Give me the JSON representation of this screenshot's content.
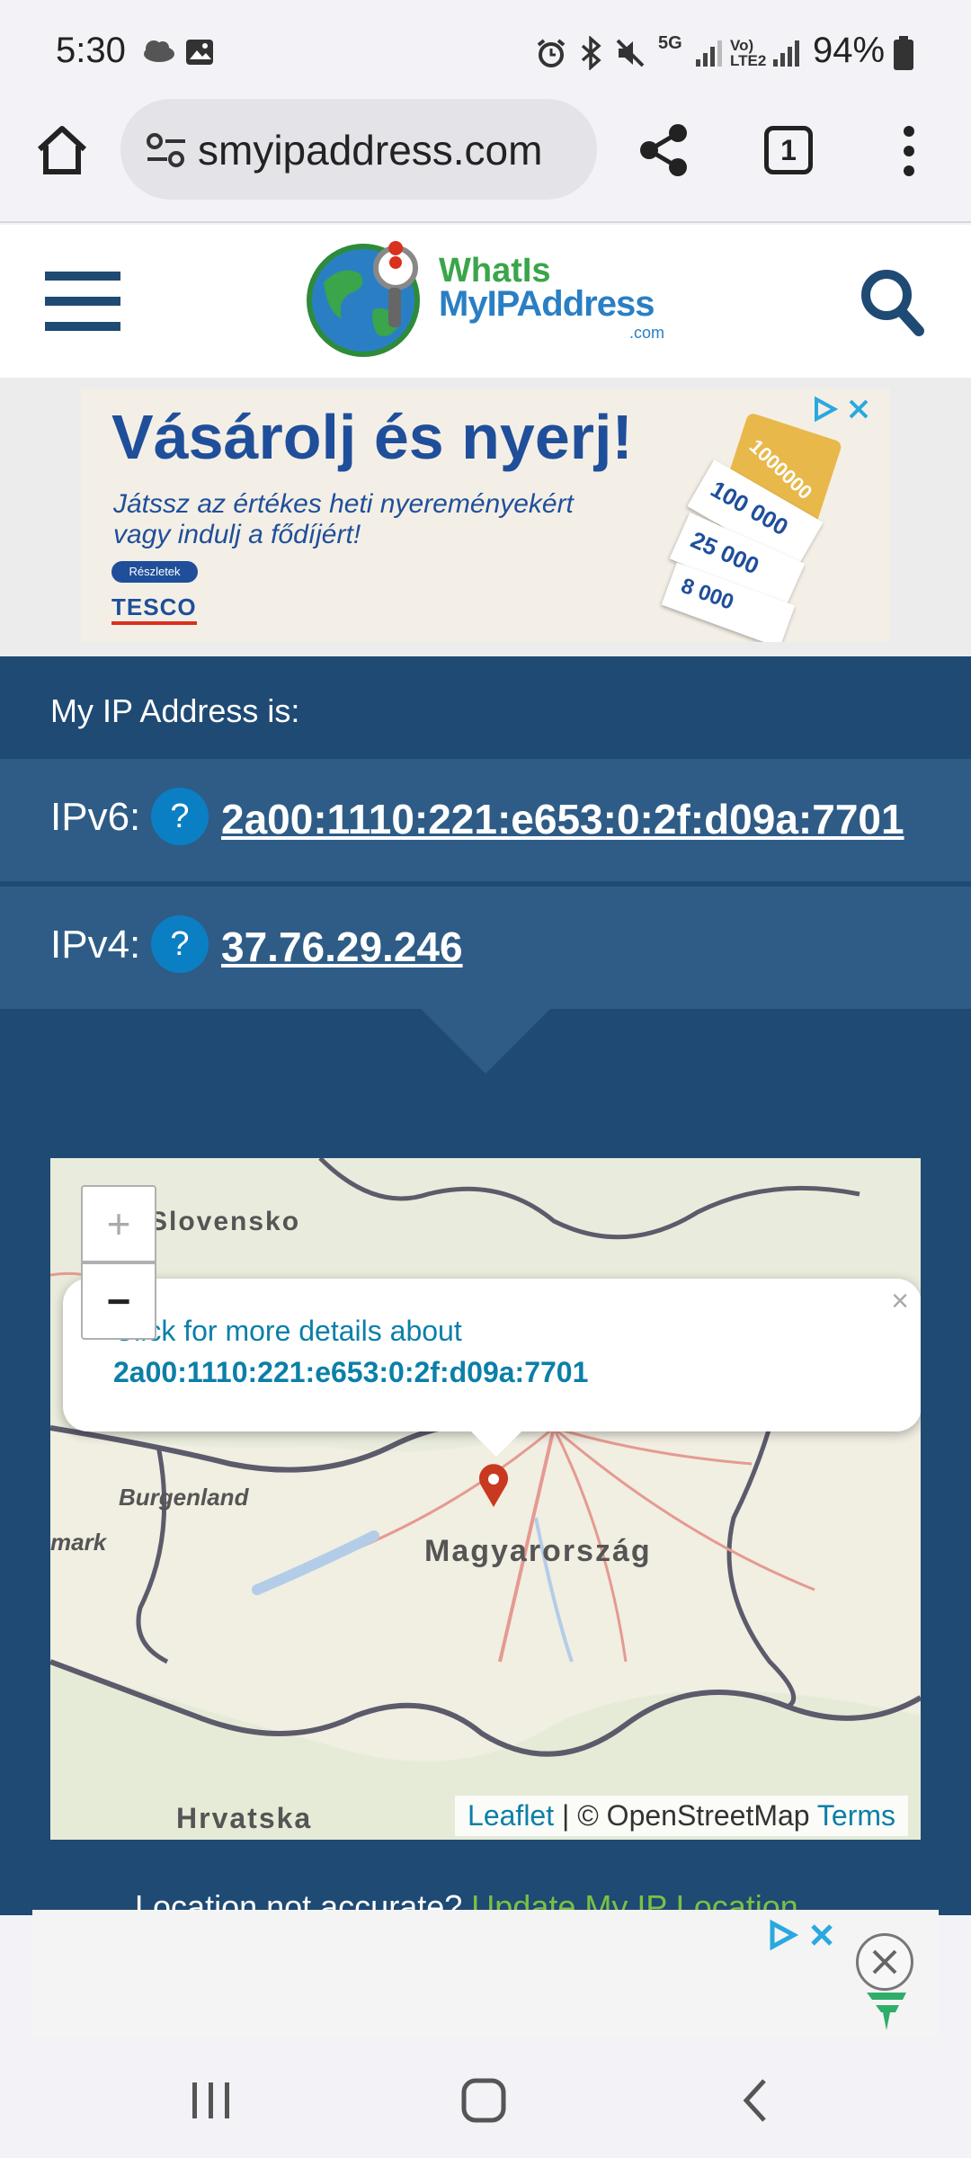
{
  "status_bar": {
    "time": "5:30",
    "network": "5G",
    "volte": "Vo) LTE2",
    "battery": "94%"
  },
  "browser": {
    "url": "smyipaddress.com",
    "tab_count": "1"
  },
  "site": {
    "logo_line1": "WhatIs",
    "logo_line2": "MyIPAddress",
    "logo_line3": ".com"
  },
  "ad": {
    "headline": "Vásárolj és nyerj!",
    "sub1": "Játssz az értékes heti nyereményekért",
    "sub2": "vagy indulj a fődíjért!",
    "button": "Részletek",
    "brand": "TESCO",
    "card1": "1000000",
    "card2": "100 000",
    "card3": "25 000",
    "card4": "8 000"
  },
  "ip": {
    "heading": "My IP Address is:",
    "ipv6_label": "IPv6:",
    "ipv6_value": "2a00:1110:221:e653:0:2f:d09a:7701",
    "ipv4_label": "IPv4:",
    "ipv4_value": "37.76.29.246",
    "help_symbol": "?"
  },
  "map": {
    "zoom_in": "+",
    "zoom_out": "−",
    "popup_line1": "Click for more details about",
    "popup_line2": "2a00:1110:221:e653:0:2f:d09a:7701",
    "popup_close": "×",
    "labels": {
      "slovakia": "Slovensko",
      "burgenland": "Burgenland",
      "mark": "mark",
      "hungary": "Magyarország",
      "croatia": "Hrvatska"
    },
    "attribution_leaflet": "Leaflet",
    "attribution_sep": " | © OpenStreetMap ",
    "attribution_terms": "Terms"
  },
  "location_note": {
    "text": "Location not accurate?",
    "link": "Update My IP Location"
  },
  "colors": {
    "panel_bg": "#1f4a73",
    "row_bg": "#2e5c86",
    "help_blue": "#0b7fc4",
    "link_green": "#7ac143"
  }
}
